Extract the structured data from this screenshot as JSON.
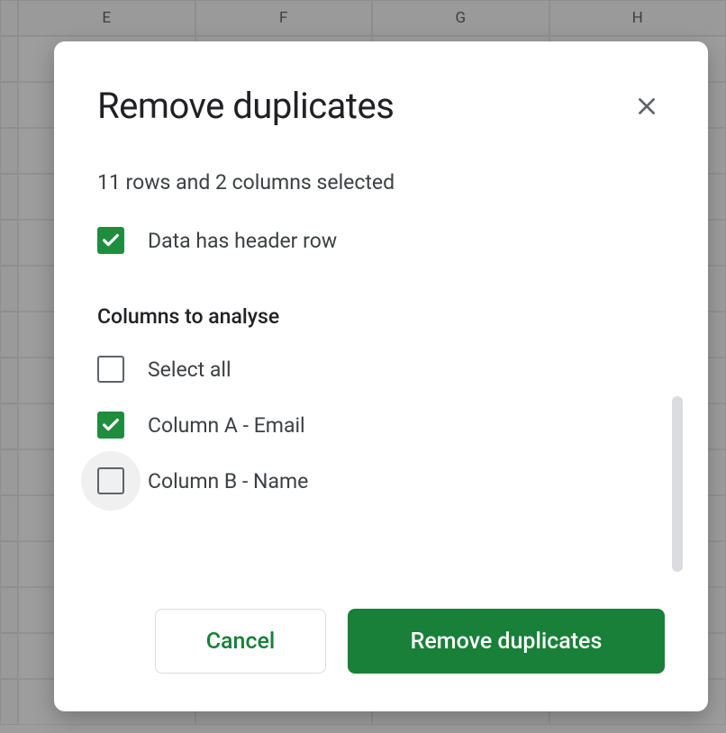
{
  "sheet": {
    "column_headers": [
      "E",
      "F",
      "G",
      "H"
    ]
  },
  "dialog": {
    "title": "Remove duplicates",
    "selection_info": "11 rows and 2 columns selected",
    "header_row_label": "Data has header row",
    "header_row_checked": true,
    "columns_heading": "Columns to analyse",
    "select_all_label": "Select all",
    "select_all_checked": false,
    "columns": [
      {
        "label": "Column A - Email",
        "checked": true
      },
      {
        "label": "Column B - Name",
        "checked": false
      }
    ],
    "cancel_label": "Cancel",
    "confirm_label": "Remove duplicates"
  }
}
